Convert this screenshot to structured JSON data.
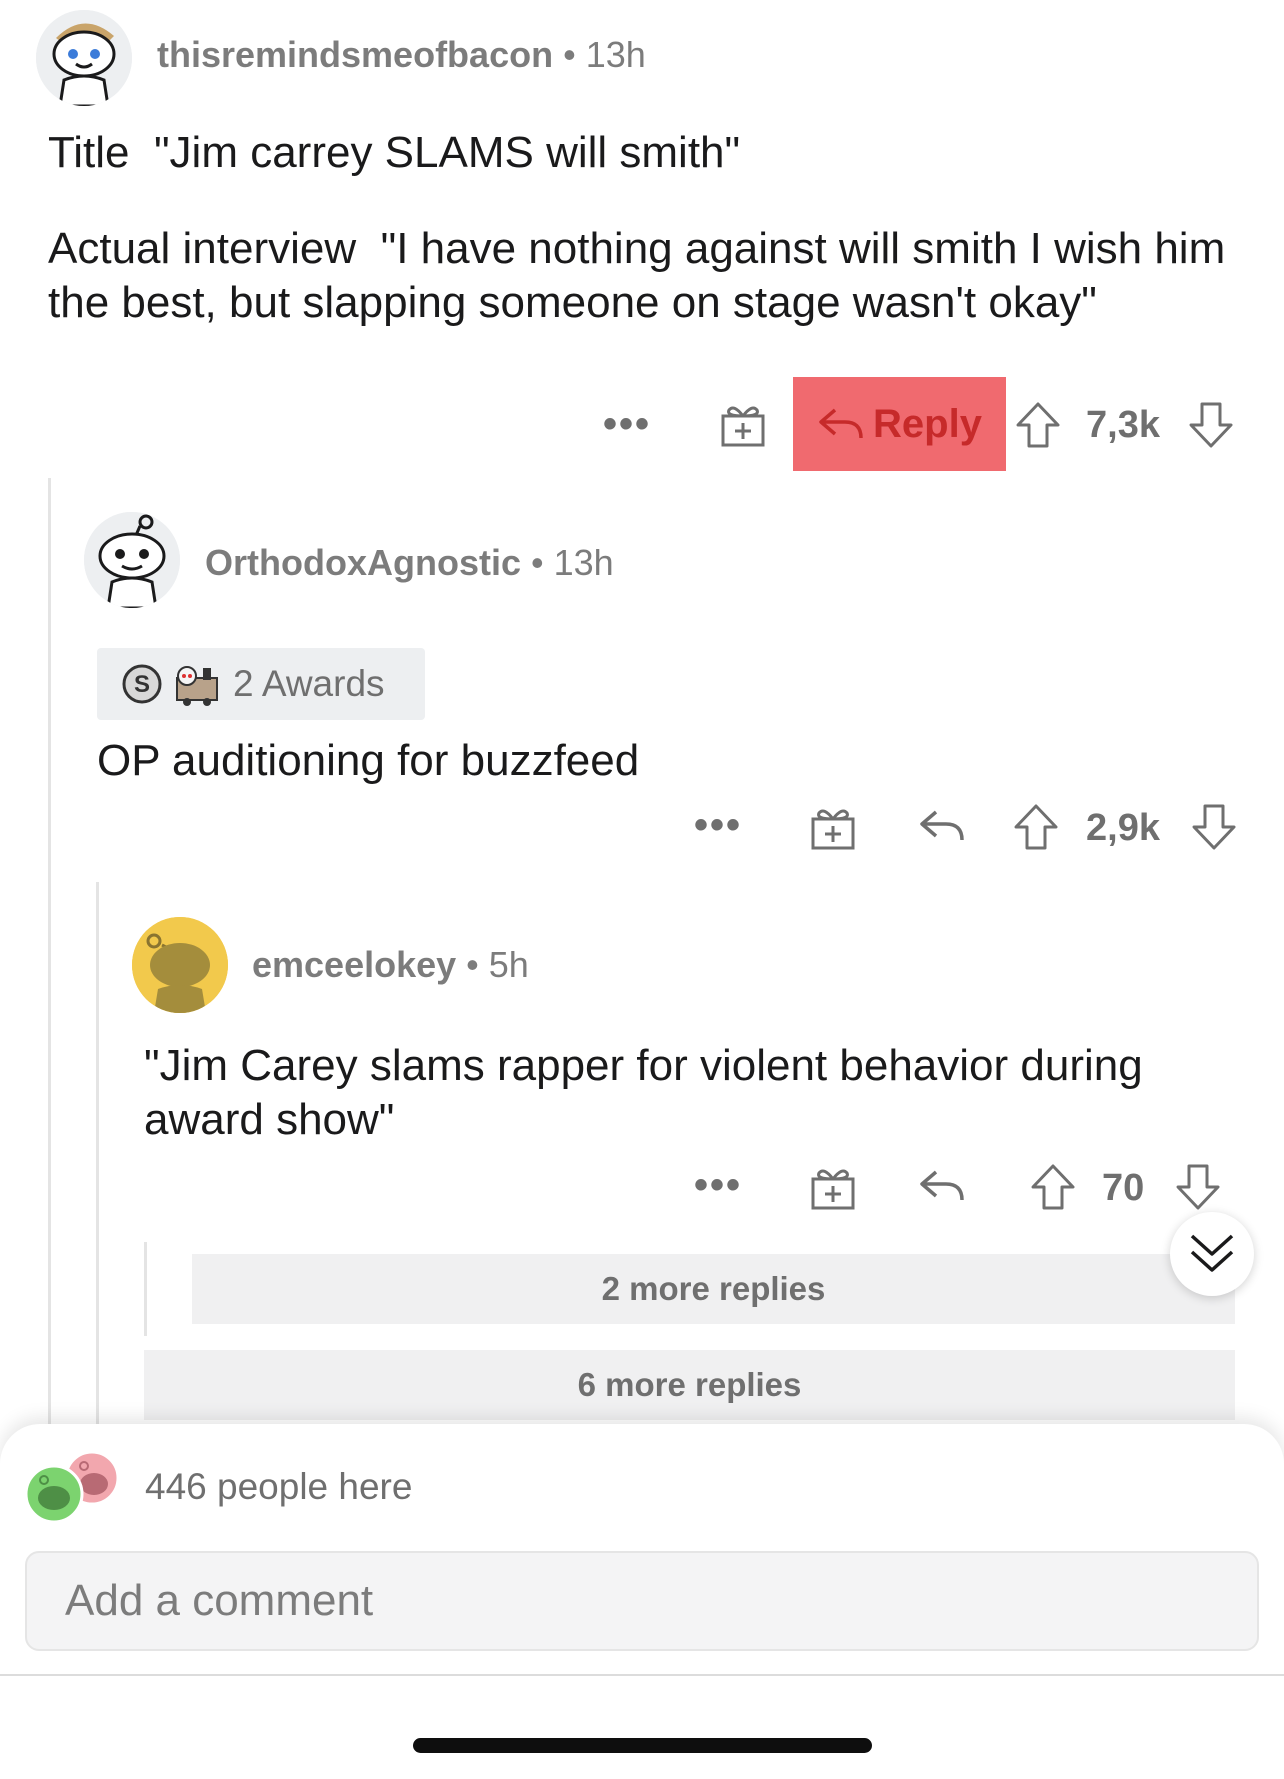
{
  "comments": [
    {
      "username": "thisremindsmeofbacon",
      "age": "13h",
      "paragraphs": [
        "Title  \"Jim carrey SLAMS will smith\"",
        "Actual interview  \"I have nothing against will smith I wish him the best, but slapping someone on stage wasn't okay\""
      ],
      "reply_label": "Reply",
      "score": "7,3k"
    },
    {
      "username": "OrthodoxAgnostic",
      "age": "13h",
      "awards_label": "2 Awards",
      "body": "OP auditioning for buzzfeed",
      "score": "2,9k"
    },
    {
      "username": "emceelokey",
      "age": "5h",
      "body": "\"Jim Carey slams rapper for violent behavior during award show\"",
      "score": "70"
    }
  ],
  "more_replies": [
    "2 more replies",
    "6 more replies"
  ],
  "separator": "•",
  "more_options": "•••",
  "footer": {
    "people_here": "446 people here",
    "comment_placeholder": "Add a comment"
  },
  "colors": {
    "reply_highlight": "#f06a6f",
    "avatar_yellow": "#f2c94c",
    "avatar_green": "#7cd36f",
    "avatar_pink": "#f2a7ae"
  }
}
